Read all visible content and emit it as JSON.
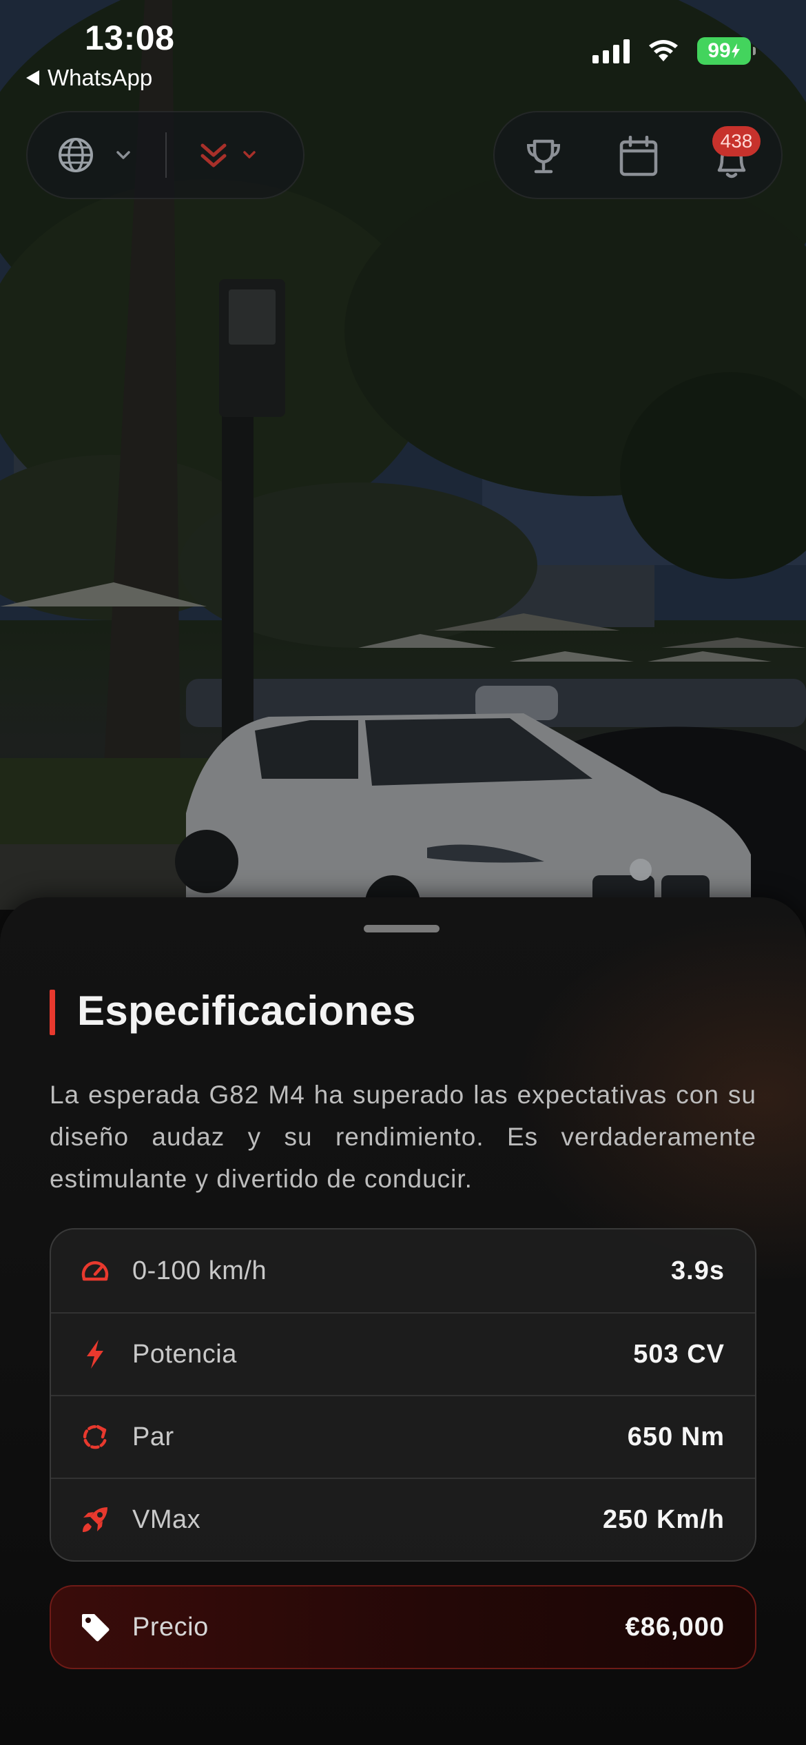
{
  "status_bar": {
    "time": "13:08",
    "back_app": "WhatsApp",
    "battery": "99"
  },
  "top_controls": {
    "left_icons": [
      "globe-icon",
      "chevron-down-icon",
      "chevron-double-down-icon",
      "chevron-down-icon"
    ],
    "right_icons": [
      "trophy-icon",
      "calendar-icon",
      "bell-icon"
    ],
    "notification_count": "438",
    "accent_color": "#e8392e"
  },
  "sheet": {
    "title": "Especificaciones",
    "description": "La esperada G82 M4 ha superado las expectativas con su diseño audaz y su rendimiento. Es verdaderamente estimulante y divertido de conducir.",
    "specs": [
      {
        "icon": "speedometer-icon",
        "label": "0-100 km/h",
        "value": "3.9s"
      },
      {
        "icon": "lightning-icon",
        "label": "Potencia",
        "value": "503 CV"
      },
      {
        "icon": "rotate-icon",
        "label": "Par",
        "value": "650 Nm"
      },
      {
        "icon": "rocket-icon",
        "label": "VMax",
        "value": "250 Km/h"
      }
    ],
    "price": {
      "icon": "tag-icon",
      "label": "Precio",
      "value": "€86,000"
    }
  }
}
